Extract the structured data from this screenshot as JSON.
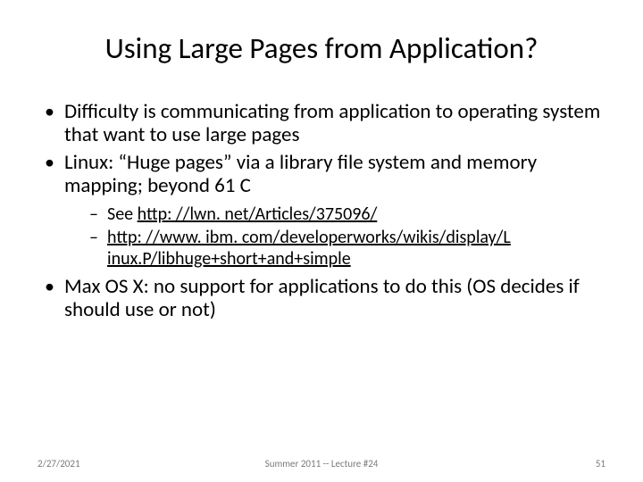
{
  "title": "Using Large Pages from Application?",
  "bullets": {
    "b1": "Difficulty is communicating from application to operating system that want to use large pages",
    "b2": "Linux: “Huge pages” via a library file system and memory mapping; beyond 61 C",
    "b3": "Max OS X: no support for applications to do this (OS decides if should use or not)"
  },
  "sub": {
    "s1_pre": "See ",
    "s1_link": "http: //lwn. net/Articles/375096/",
    "s2_link": "http: //www. ibm. com/developerworks/wikis/display/L inux.P/libhuge+short+and+simple"
  },
  "footer": {
    "date": "2/27/2021",
    "center": "Summer 2011 -- Lecture #24",
    "page": "51"
  }
}
